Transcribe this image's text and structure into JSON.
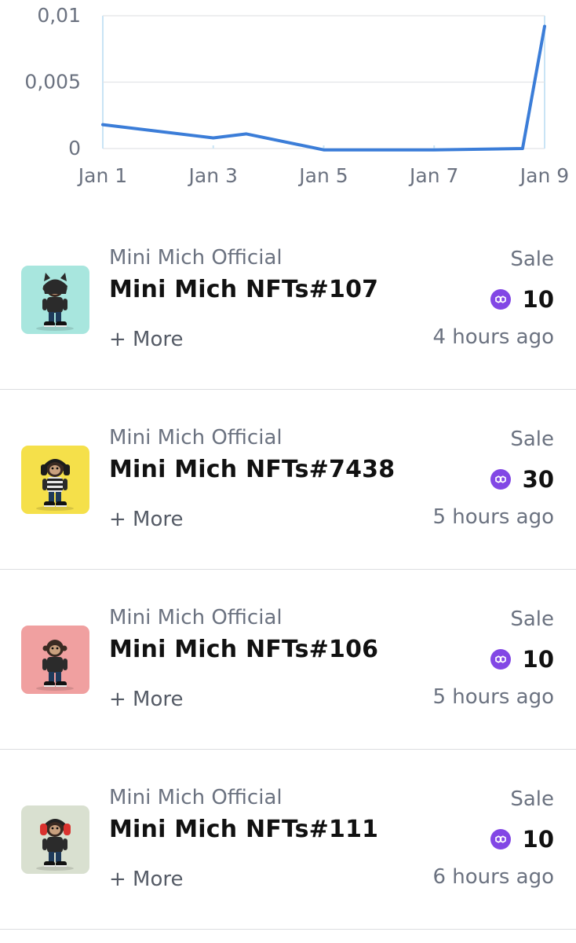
{
  "chart_data": {
    "type": "line",
    "x_tick_labels": [
      "Jan 1",
      "Jan 3",
      "Jan 5",
      "Jan 7",
      "Jan 9"
    ],
    "y_tick_labels": [
      "0,01",
      "0,005",
      "0"
    ],
    "yticks": [
      0.01,
      0.005,
      0
    ],
    "ylim": [
      0,
      0.01
    ],
    "xlim": [
      1,
      9
    ],
    "series": [
      {
        "x": [
          1,
          3,
          3.6,
          5,
          7,
          8.6,
          9
        ],
        "values": [
          0.0018,
          0.0008,
          0.0011,
          -0.0001,
          -0.0001,
          0.0,
          0.0092
        ],
        "color": "#3b7dd8"
      }
    ],
    "grid": true
  },
  "activities": [
    {
      "collection": "Mini Mich Official",
      "name": "Mini Mich NFTs#107",
      "more": "+ More",
      "event": "Sale",
      "price": "10",
      "token_icon": "polygon-matic-icon",
      "time": "4 hours ago",
      "thumb_bg": "#a8e6de",
      "headwear": "cat-ears-hoodie"
    },
    {
      "collection": "Mini Mich Official",
      "name": "Mini Mich NFTs#7438",
      "more": "+ More",
      "event": "Sale",
      "price": "30",
      "token_icon": "polygon-matic-icon",
      "time": "5 hours ago",
      "thumb_bg": "#f5e04a",
      "headwear": "headphones"
    },
    {
      "collection": "Mini Mich Official",
      "name": "Mini Mich NFTs#106",
      "more": "+ More",
      "event": "Sale",
      "price": "10",
      "token_icon": "polygon-matic-icon",
      "time": "5 hours ago",
      "thumb_bg": "#f0a0a0",
      "headwear": "none"
    },
    {
      "collection": "Mini Mich Official",
      "name": "Mini Mich NFTs#111",
      "more": "+ More",
      "event": "Sale",
      "price": "10",
      "token_icon": "polygon-matic-icon",
      "time": "6 hours ago",
      "thumb_bg": "#d9e0d0",
      "headwear": "red-headphones"
    }
  ]
}
